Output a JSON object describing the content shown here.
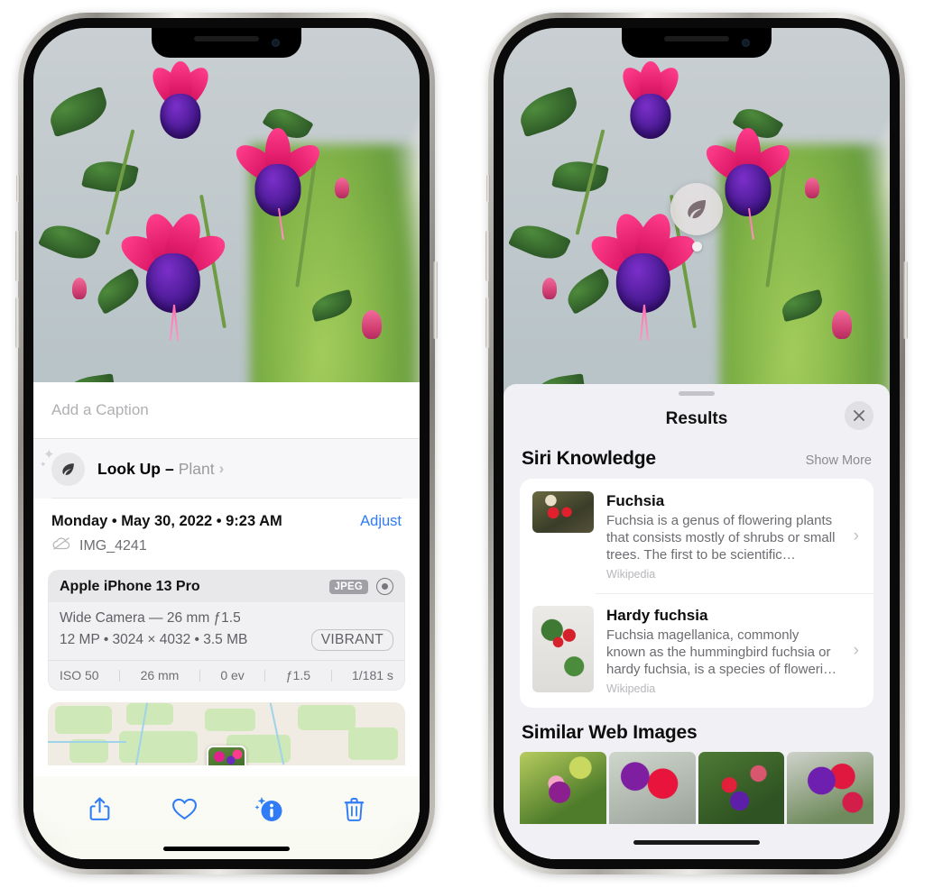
{
  "left_phone": {
    "caption_placeholder": "Add a Caption",
    "lookup": {
      "label": "Look Up",
      "dash": "–",
      "subject": "Plant",
      "chevron": "›",
      "icon": "leaf-icon"
    },
    "meta": {
      "date": "Monday • May 30, 2022 • 9:23 AM",
      "adjust_label": "Adjust",
      "filename": "IMG_4241",
      "cloud_icon": "icloud-slash-icon"
    },
    "camera": {
      "device": "Apple iPhone 13 Pro",
      "format_tag": "JPEG",
      "aperture_icon": "aperture-icon",
      "lens_line": "Wide Camera — 26 mm ƒ1.5",
      "specs_line": "12 MP • 3024 × 4032 • 3.5 MB",
      "style_tag": "VIBRANT",
      "exif": [
        "ISO 50",
        "26 mm",
        "0 ev",
        "ƒ1.5",
        "1/181 s"
      ]
    },
    "toolbar": [
      {
        "name": "share-icon",
        "label": "Share"
      },
      {
        "name": "heart-icon",
        "label": "Favorite"
      },
      {
        "name": "info-sparkle-icon",
        "label": "Info"
      },
      {
        "name": "trash-icon",
        "label": "Delete"
      }
    ]
  },
  "right_phone": {
    "visual_lookup_badge": {
      "icon": "leaf-icon"
    },
    "sheet": {
      "title": "Results",
      "close_icon": "close-icon"
    },
    "siri_knowledge": {
      "heading": "Siri Knowledge",
      "show_more": "Show More",
      "cards": [
        {
          "title": "Fuchsia",
          "description": "Fuchsia is a genus of flowering plants that consists mostly of shrubs or small trees. The first to be scientific…",
          "source": "Wikipedia",
          "chevron": "›"
        },
        {
          "title": "Hardy fuchsia",
          "description": "Fuchsia magellanica, commonly known as the hummingbird fuchsia or hardy fuchsia, is a species of floweri…",
          "source": "Wikipedia",
          "chevron": "›"
        }
      ]
    },
    "similar_web_images": {
      "heading": "Similar Web Images",
      "thumbnails": [
        "fuchsia-pink-purple",
        "fuchsia-red-closeup",
        "fuchsia-bush",
        "fuchsia-purple-magenta"
      ]
    }
  },
  "colors": {
    "accent_blue": "#2f7cf6",
    "sheet_bg": "#f1f0f5",
    "card_bg": "#ffffff",
    "secondary_text": "#6c6c71"
  }
}
